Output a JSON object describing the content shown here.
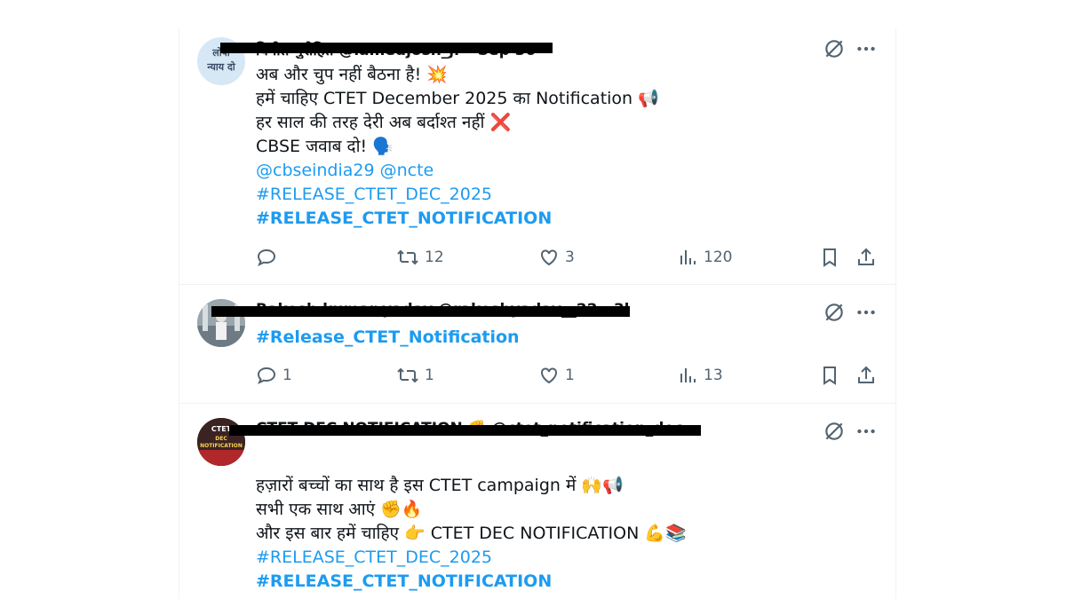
{
  "tweets": [
    {
      "author_blur": "विनीत पुरोहित @lamedjosh_jr · Sep 30",
      "avatar_text_line1": "लोपी",
      "avatar_text_line2": "न्याय दो",
      "lines": [
        "अब और चुप नहीं बैठना है! 💥",
        "हमें चाहिए CTET December 2025 का Notification 📢",
        "हर साल की तरह देरी अब बर्दाश्त नहीं ❌",
        " CBSE जवाब दो! 🗣️"
      ],
      "mentions": "@cbseindia29 @ncte",
      "hashtag1": "#RELEASE_CTET_DEC_2025",
      "hashtag2": "#RELEASE_CTET_NOTIFICATION",
      "replies": "",
      "retweets": "12",
      "likes": "3",
      "views": "120"
    },
    {
      "author_blur": "Rakesh kumar yadav @rakeshyadav__22 · 3h",
      "hashtag": "#Release_CTET_Notification",
      "replies": "1",
      "retweets": "1",
      "likes": "1",
      "views": "13"
    },
    {
      "author_blur": "CTET DEC NOTIFICATION ✊ @ctet_notification_dec · Sep 30",
      "avatar_text_line1": "CTET",
      "avatar_text_line2": "DEC NOTIFICATION",
      "lines": [
        "हज़ारों बच्चों का साथ है इस CTET campaign में 🙌📢",
        "सभी एक साथ आएं ✊🔥",
        "और इस बार हमें चाहिए 👉 CTET DEC NOTIFICATION 💪📚"
      ],
      "hashtag1": "#RELEASE_CTET_DEC_2025",
      "hashtag2": "#RELEASE_CTET_NOTIFICATION"
    }
  ],
  "colors": {
    "link": "#1d9bf0",
    "text": "#0f1419",
    "muted": "#536471",
    "border": "#eff3f4"
  },
  "icons": [
    "grok-icon",
    "more-icon",
    "reply-icon",
    "retweet-icon",
    "like-icon",
    "views-icon",
    "bookmark-icon",
    "share-icon"
  ]
}
